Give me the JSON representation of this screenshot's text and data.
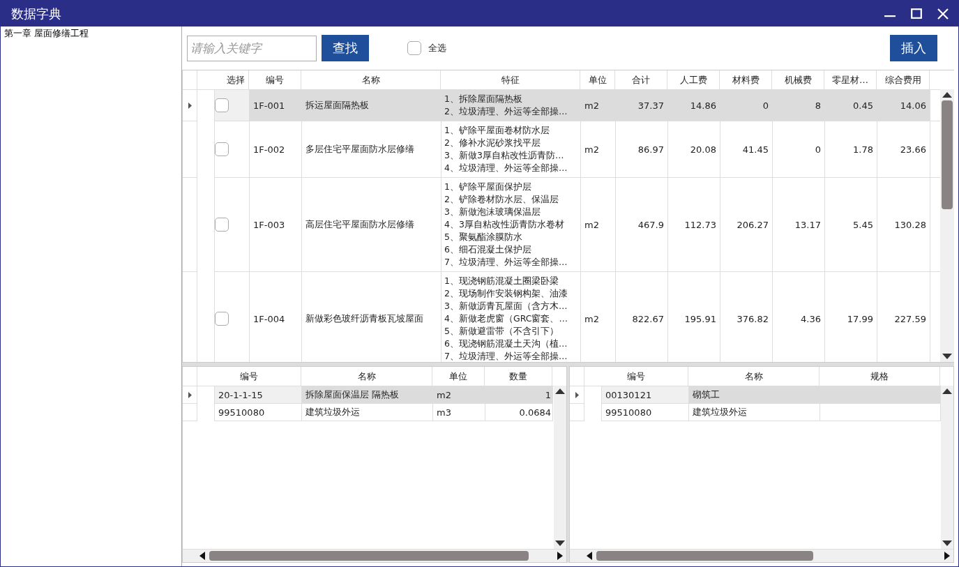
{
  "window": {
    "title": "数据字典"
  },
  "tree": {
    "items": [
      {
        "label": "第一章 屋面修缮工程",
        "selected": false
      }
    ]
  },
  "toolbar": {
    "search": {
      "placeholder": "请输入关键字"
    },
    "find_button": "查找",
    "select_all": {
      "label": "全选",
      "checked": false
    },
    "insert_button": "插入"
  },
  "items_table": {
    "columns": [
      "选择",
      "编号",
      "名称",
      "特征",
      "单位",
      "合计",
      "人工费",
      "材料费",
      "机械费",
      "零星材…",
      "综合费用"
    ],
    "rows": [
      {
        "selected": true,
        "checked": false,
        "code": "1F-001",
        "name": "拆运屋面隔热板",
        "features": [
          "1、拆除屋面隔热板",
          "2、垃圾清理、外运等全部操…"
        ],
        "unit": "m2",
        "amounts": [
          "37.37",
          "14.86",
          "0",
          "8",
          "0.45",
          "14.06"
        ]
      },
      {
        "selected": false,
        "checked": false,
        "code": "1F-002",
        "name": "多层住宅平屋面防水层修缮",
        "features": [
          "1、铲除平屋面卷材防水层",
          "2、修补水泥砂浆找平层",
          "3、新做3厚自粘改性沥青防…",
          "4、垃圾清理、外运等全部操…"
        ],
        "unit": "m2",
        "amounts": [
          "86.97",
          "20.08",
          "41.45",
          "0",
          "1.78",
          "23.66"
        ]
      },
      {
        "selected": false,
        "checked": false,
        "code": "1F-003",
        "name": "高层住宅平屋面防水层修缮",
        "features": [
          "1、铲除平屋面保护层",
          "2、铲除卷材防水层、保温层",
          "3、新做泡沫玻璃保温层",
          "4、3厚自粘改性沥青防水卷材",
          "5、聚氨酯涂膜防水",
          "6、细石混凝土保护层",
          "7、垃圾清理、外运等全部操…"
        ],
        "unit": "m2",
        "amounts": [
          "467.9",
          "112.73",
          "206.27",
          "13.17",
          "5.45",
          "130.28"
        ]
      },
      {
        "selected": false,
        "checked": false,
        "code": "1F-004",
        "name": "新做彩色玻纤沥青板瓦坡屋面",
        "features": [
          "1、现浇钢筋混凝土圈梁卧梁",
          "2、现场制作安装钢构架、油漆",
          "3、新做沥青瓦屋面（含方木…",
          "4、新做老虎窗（GRC窗套、…",
          "5、新做避雷带（不含引下）",
          "6、现浇钢筋混凝土天沟（植…",
          "7、垃圾清理、外运等全部操…"
        ],
        "unit": "m2",
        "amounts": [
          "822.67",
          "195.91",
          "376.82",
          "4.36",
          "17.99",
          "227.59"
        ]
      }
    ]
  },
  "quota_table": {
    "columns": [
      "编号",
      "名称",
      "单位",
      "数量"
    ],
    "rows": [
      {
        "selected": true,
        "cells": [
          "20-1-1-15",
          "拆除屋面保温层 隔热板",
          "m2",
          "1"
        ]
      },
      {
        "selected": false,
        "cells": [
          "99510080",
          "建筑垃圾外运",
          "m3",
          "0.0684"
        ]
      }
    ]
  },
  "resource_table": {
    "columns": [
      "编号",
      "名称",
      "规格"
    ],
    "rows": [
      {
        "selected": true,
        "cells": [
          "00130121",
          "砌筑工",
          ""
        ]
      },
      {
        "selected": false,
        "cells": [
          "99510080",
          "建筑垃圾外运",
          ""
        ]
      }
    ]
  }
}
